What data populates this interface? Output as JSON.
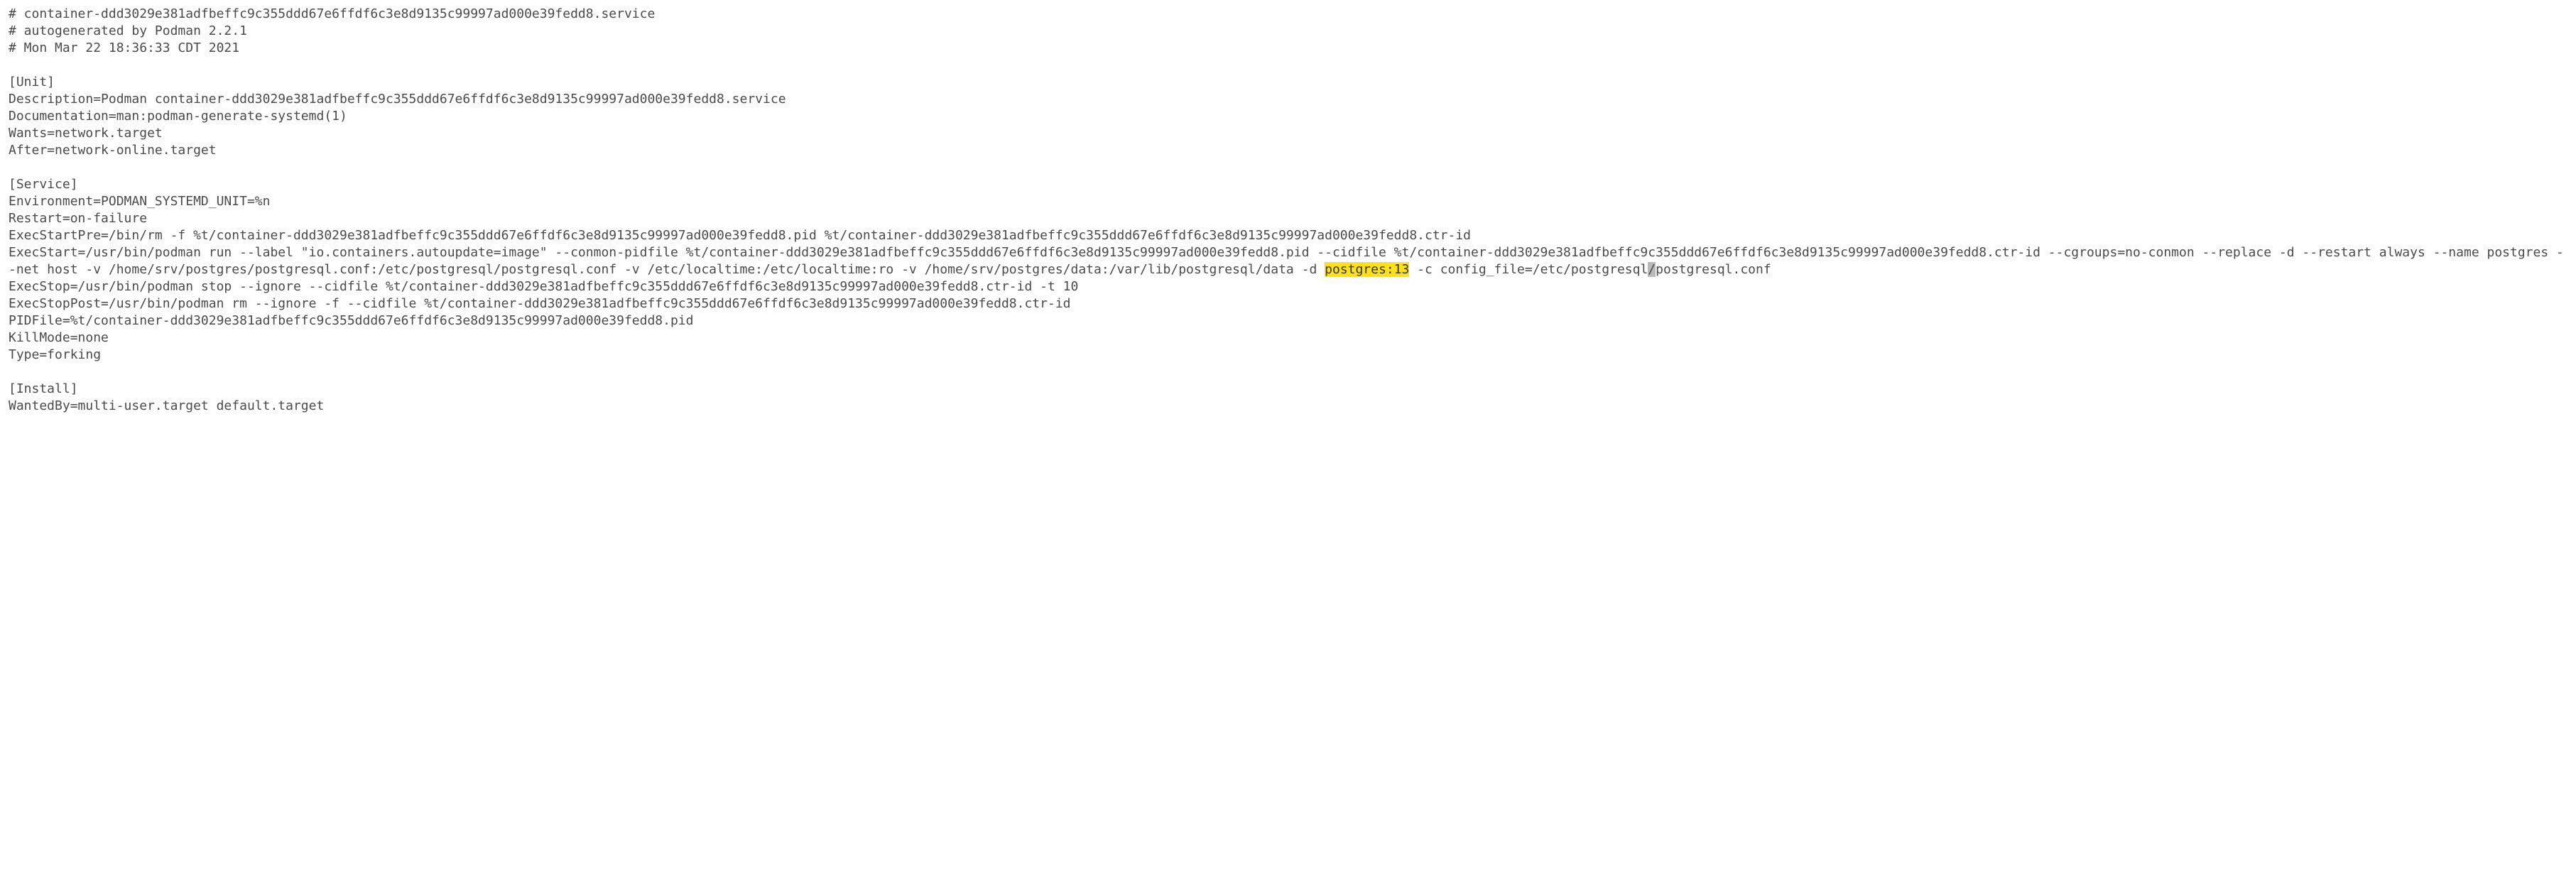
{
  "header": {
    "comment1": "# container-ddd3029e381adfbeffc9c355ddd67e6ffdf6c3e8d9135c99997ad000e39fedd8.service",
    "comment2": "# autogenerated by Podman 2.2.1",
    "comment3": "# Mon Mar 22 18:36:33 CDT 2021"
  },
  "unit": {
    "heading": "[Unit]",
    "description": "Description=Podman container-ddd3029e381adfbeffc9c355ddd67e6ffdf6c3e8d9135c99997ad000e39fedd8.service",
    "documentation": "Documentation=man:podman-generate-systemd(1)",
    "wants": "Wants=network.target",
    "after": "After=network-online.target"
  },
  "service": {
    "heading": "[Service]",
    "environment": "Environment=PODMAN_SYSTEMD_UNIT=%n",
    "restart": "Restart=on-failure",
    "execstartpre": "ExecStartPre=/bin/rm -f %t/container-ddd3029e381adfbeffc9c355ddd67e6ffdf6c3e8d9135c99997ad000e39fedd8.pid %t/container-ddd3029e381adfbeffc9c355ddd67e6ffdf6c3e8d9135c99997ad000e39fedd8.ctr-id",
    "execstart_pre": "ExecStart=/usr/bin/podman run --label \"io.containers.autoupdate=image\" --conmon-pidfile %t/container-ddd3029e381adfbeffc9c355ddd67e6ffdf6c3e8d9135c99997ad000e39fedd8.pid --cidfile %t/container-ddd3029e381adfbeffc9c355ddd67e6ffdf6c3e8d9135c99997ad000e39fedd8.ctr-id --cgroups=no-conmon --replace -d --restart always --name postgres --net host -v /home/srv/postgres/postgresql.conf:/etc/postgresql/postgresql.conf -v /etc/localtime:/etc/localtime:ro -v /home/srv/postgres/data:/var/lib/postgresql/data -d ",
    "execstart_highlight": "postgres:13",
    "execstart_mid": " -c config_file=/etc/postgresql",
    "execstart_cursor": "/",
    "execstart_post": "postgresql.conf",
    "execstop": "ExecStop=/usr/bin/podman stop --ignore --cidfile %t/container-ddd3029e381adfbeffc9c355ddd67e6ffdf6c3e8d9135c99997ad000e39fedd8.ctr-id -t 10",
    "execstoppost": "ExecStopPost=/usr/bin/podman rm --ignore -f --cidfile %t/container-ddd3029e381adfbeffc9c355ddd67e6ffdf6c3e8d9135c99997ad000e39fedd8.ctr-id",
    "pidfile": "PIDFile=%t/container-ddd3029e381adfbeffc9c355ddd67e6ffdf6c3e8d9135c99997ad000e39fedd8.pid",
    "killmode": "KillMode=none",
    "type": "Type=forking"
  },
  "install": {
    "heading": "[Install]",
    "wantedby": "WantedBy=multi-user.target default.target"
  }
}
